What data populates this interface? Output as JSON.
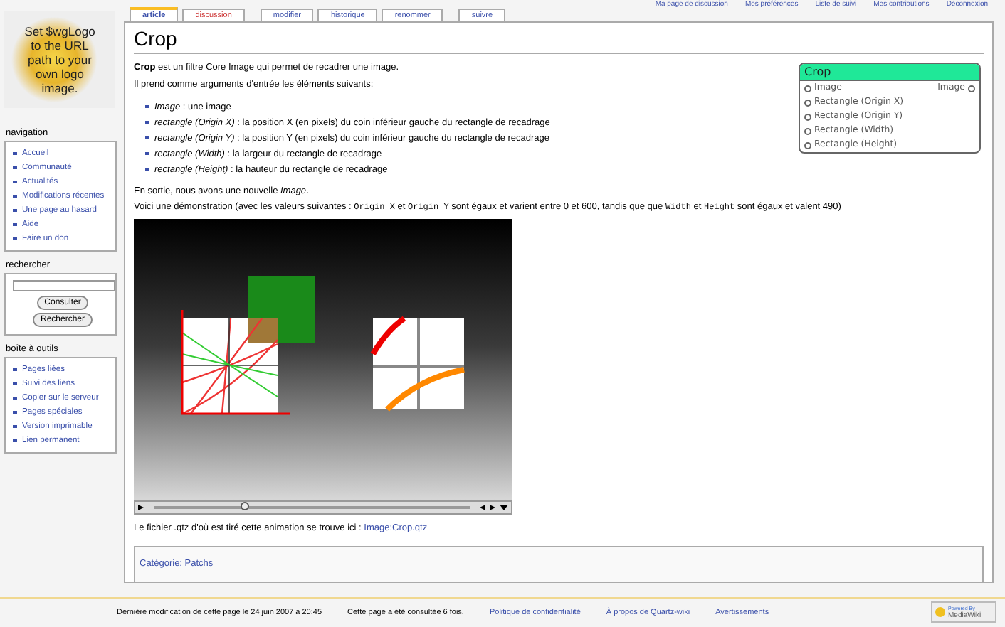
{
  "personal_links": [
    "Ma page de discussion",
    "Mes préférences",
    "Liste de suivi",
    "Mes contributions",
    "Déconnexion"
  ],
  "logo_text": "Set $wgLogo to the URL path to your own logo image.",
  "sidebar": [
    {
      "title": "navigation",
      "kind": "links",
      "items": [
        "Accueil",
        "Communauté",
        "Actualités",
        "Modifications récentes",
        "Une page au hasard",
        "Aide",
        "Faire un don"
      ]
    },
    {
      "title": "rechercher",
      "kind": "search",
      "buttons": [
        "Consulter",
        "Rechercher"
      ]
    },
    {
      "title": "boîte à outils",
      "kind": "links",
      "items": [
        "Pages liées",
        "Suivi des liens",
        "Copier sur le serveur",
        "Pages spéciales",
        "Version imprimable",
        "Lien permanent"
      ]
    }
  ],
  "tabs": [
    {
      "label": "article",
      "selected": true,
      "missing": false
    },
    {
      "label": "discussion",
      "selected": false,
      "missing": true
    },
    {
      "label": "modifier",
      "selected": false,
      "missing": false
    },
    {
      "label": "historique",
      "selected": false,
      "missing": false
    },
    {
      "label": "renommer",
      "selected": false,
      "missing": false
    },
    {
      "label": "suivre",
      "selected": false,
      "missing": false
    }
  ],
  "title": "Crop",
  "intro": [
    "**Crop** est un filtre Core Image qui permet de recadrer une image.",
    "Il prend comme arguments d'entrée les éléments suivants:"
  ],
  "arguments": [
    "*Image* : une image",
    "*rectangle (Origin X)* : la position X (en pixels) du coin inférieur gauche du rectangle de recadrage",
    "*rectangle (Origin Y)* : la position Y (en pixels) du coin inférieur gauche du rectangle de recadrage",
    "*rectangle (Width)* : la largeur du rectangle de recadrage",
    "*rectangle (Height)* : la hauteur du rectangle de recadrage"
  ],
  "output_text": "En sortie, nous avons une nouvelle *Image*.",
  "demo_text": [
    "Voici une démonstration (avec les valeurs suivantes : ",
    "Origin X",
    " et ",
    "Origin Y",
    " sont égaux et varient entre 0 et 600, tandis que que ",
    "Width",
    " et ",
    "Height",
    " sont égaux et valent 490)"
  ],
  "patch": {
    "title": "Crop",
    "inputs": [
      "Image",
      "Rectangle (Origin X)",
      "Rectangle (Origin Y)",
      "Rectangle (Width)",
      "Rectangle (Height)"
    ],
    "outputs": [
      "Image"
    ]
  },
  "video": {
    "level": 0.29
  },
  "file_text": "Le fichier .qtz d'où est tiré cette animation se trouve ici : ",
  "file_link": "Image:Crop.qtz",
  "category": "Catégorie: Patchs",
  "footer": {
    "texts": [
      "Dernière modification de cette page le 24 juin 2007 à 20:45",
      "Cette page a été consultée 6 fois."
    ],
    "links": [
      "Politique de confidentialité",
      "À propos de Quartz-wiki",
      "Avertissements"
    ],
    "badge": [
      "Powered By",
      "MediaWiki"
    ]
  }
}
